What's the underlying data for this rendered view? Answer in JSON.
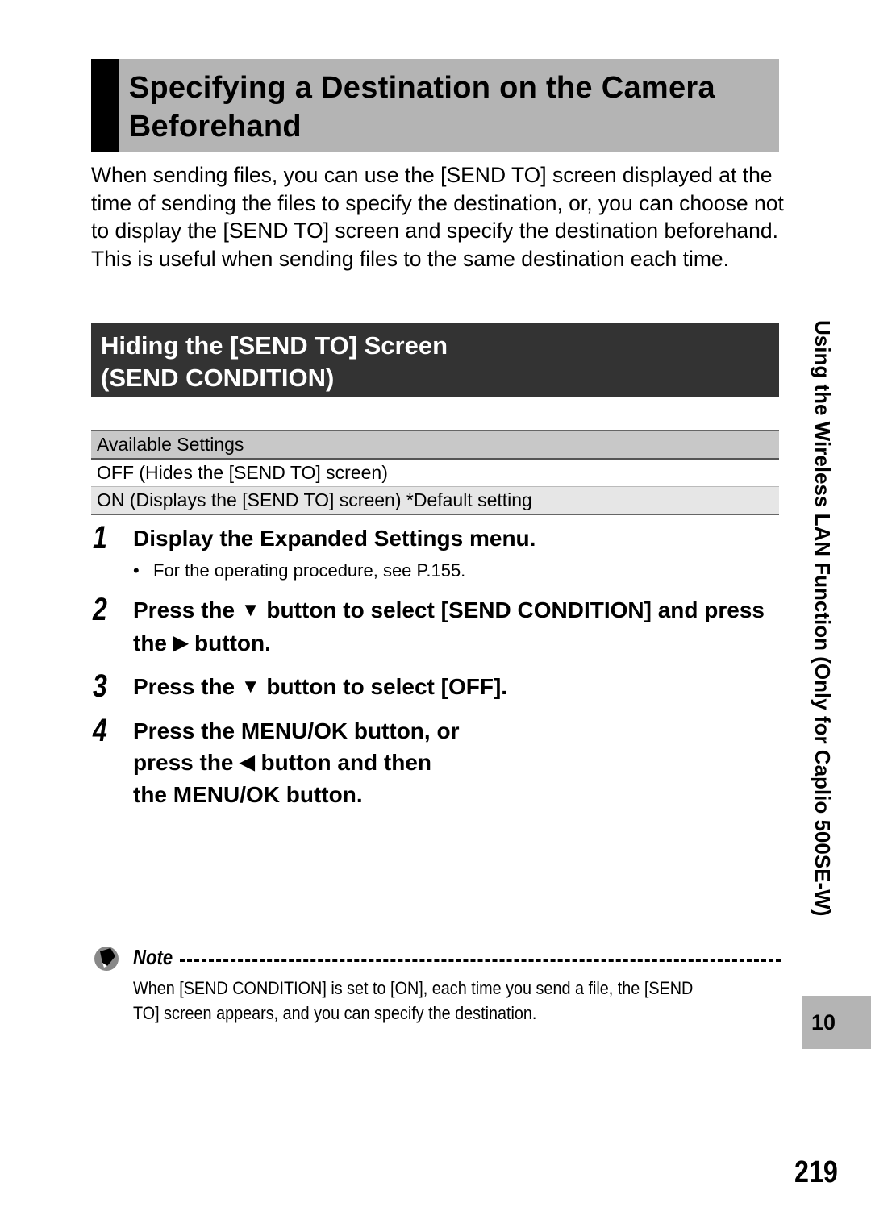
{
  "title": "Specifying a Destination on the Camera Beforehand",
  "intro": "When sending files, you can use the [SEND TO] screen displayed at the time of sending the files to specify the destination, or, you can choose not to display the [SEND TO] screen and specify the destination beforehand. This is useful when sending files to the same destination each time.",
  "section": {
    "heading": "Hiding the [SEND TO] Screen\n(SEND CONDITION)"
  },
  "settings_table": {
    "header": "Available Settings",
    "rows": [
      "OFF (Hides the [SEND TO] screen)",
      "ON (Displays the [SEND TO] screen) *Default setting"
    ]
  },
  "steps": [
    {
      "number": "1",
      "text": "Display the Expanded Settings menu.",
      "sub": "For the operating procedure, see P.155."
    },
    {
      "number": "2",
      "parts": [
        "Press the",
        "button to select [SEND CONDITION] and press the",
        "button."
      ],
      "icons": [
        "down-arrow",
        "right-arrow"
      ]
    },
    {
      "number": "3",
      "parts": [
        "Press the",
        "button to select [OFF]."
      ],
      "icons": [
        "down-arrow"
      ]
    },
    {
      "number": "4",
      "parts": [
        "Press the MENU/OK button, or",
        "press the",
        "button and then",
        "the MENU/OK button."
      ],
      "icons": [
        "left-arrow"
      ]
    }
  ],
  "glyphs": {
    "down": "▼",
    "right": "▶",
    "left": "◀"
  },
  "note": {
    "title": "Note",
    "body": "When [SEND CONDITION] is set to [ON], each time you send a file, the [SEND TO] screen appears, and you can specify the destination."
  },
  "side_label": "Using the Wireless LAN Function (Only for Caplio 500SE-W)",
  "chapter": "10",
  "page_number": "219"
}
